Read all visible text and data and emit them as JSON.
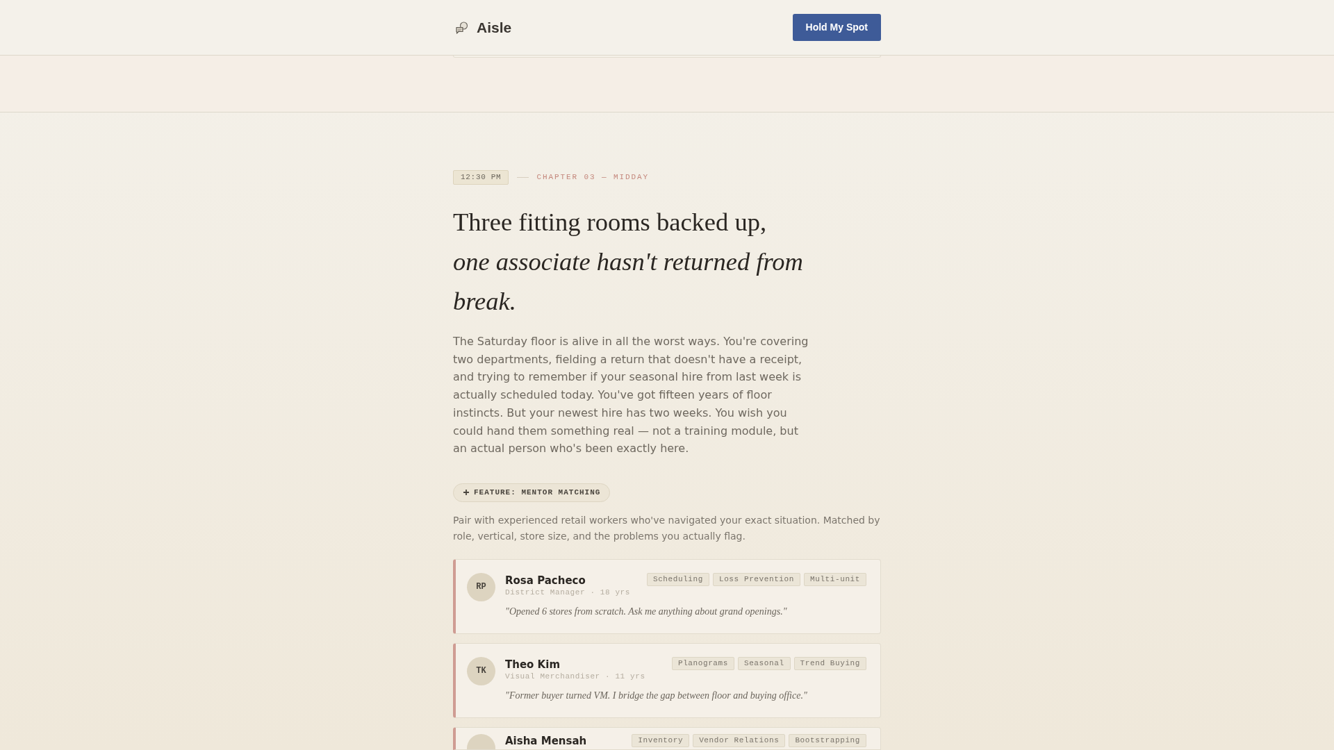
{
  "header": {
    "brand": "Aisle",
    "button": "Hold My Spot"
  },
  "chapter": {
    "time": "12:30 PM",
    "label": "CHAPTER 03 — MIDDAY"
  },
  "headline": {
    "lead": "Three fitting rooms backed up,",
    "emphasis": "one associate hasn't returned from break."
  },
  "intro": "The Saturday floor is alive in all the worst ways. You're covering two departments, fielding a return that doesn't have a receipt, and trying to remember if your seasonal hire from last week is actually scheduled today. You've got fifteen years of floor instincts. But your newest hire has two weeks. You wish you could hand them something real — not a training module, but an actual person who's been exactly here.",
  "feature": {
    "badge": "FEATURE: MENTOR MATCHING",
    "description": "Pair with experienced retail workers who've navigated your exact situation. Matched by role, vertical, store size, and the problems you actually flag."
  },
  "mentors": [
    {
      "initials": "RP",
      "name": "Rosa Pacheco",
      "role": "District Manager · 18 yrs",
      "quote": "\"Opened 6 stores from scratch. Ask me anything about grand openings.\"",
      "tags": [
        "Scheduling",
        "Loss Prevention",
        "Multi-unit"
      ]
    },
    {
      "initials": "TK",
      "name": "Theo Kim",
      "role": "Visual Merchandiser · 11 yrs",
      "quote": "\"Former buyer turned VM. I bridge the gap between floor and buying office.\"",
      "tags": [
        "Planograms",
        "Seasonal",
        "Trend Buying"
      ]
    },
    {
      "name": "Aisha Mensah",
      "tags": [
        "Inventory",
        "Vendor Relations",
        "Bootstrapping"
      ]
    }
  ]
}
